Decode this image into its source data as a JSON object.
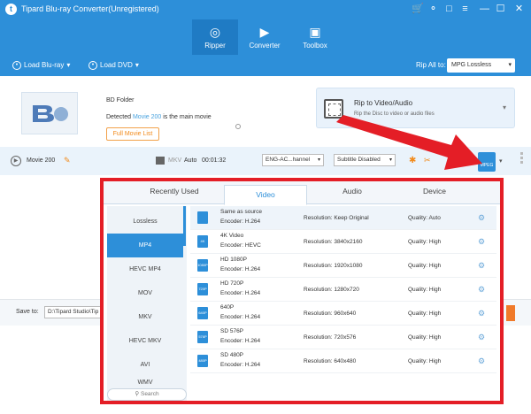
{
  "app": {
    "title": "Tipard Blu-ray Converter(Unregistered)"
  },
  "window_controls": {
    "cart_icon": "cart-icon",
    "key_icon": "key-icon",
    "chat_icon": "chat-icon",
    "menu_icon": "menu-icon",
    "minimize": "—",
    "maximize": "☐",
    "close": "✕"
  },
  "top_tabs": [
    {
      "label": "Ripper",
      "icon": "ripper-icon",
      "active": true
    },
    {
      "label": "Converter",
      "icon": "converter-icon",
      "active": false
    },
    {
      "label": "Toolbox",
      "icon": "toolbox-icon",
      "active": false
    }
  ],
  "toolbar": {
    "load_bluray": "Load Blu-ray",
    "load_dvd": "Load DVD",
    "rip_all_label": "Rip All to:",
    "rip_all_value": "MPG Lossless"
  },
  "source": {
    "folder": "BD Folder",
    "detected_prefix": "Detected ",
    "detected_movie": "Movie 200",
    "detected_suffix": " is the main movie",
    "full_list_button": "Full Movie List"
  },
  "rip_mode": {
    "title": "Rip to Video/Audio",
    "description": "Rip the Disc to video or audio files"
  },
  "movie_row": {
    "name": "Movie 200",
    "format": "MKV",
    "resolution": "Auto",
    "duration": "00:01:32",
    "audio_track": "ENG-AC...hannel",
    "subtitle": "Subtitle Disabled",
    "format_badge": "MPEG"
  },
  "save": {
    "label": "Save to:",
    "path": "D:\\Tipard Studio\\Tip"
  },
  "popup": {
    "tabs": [
      {
        "label": "Recently Used",
        "active": false
      },
      {
        "label": "Video",
        "active": true
      },
      {
        "label": "Audio",
        "active": false
      },
      {
        "label": "Device",
        "active": false
      }
    ],
    "categories": [
      "Lossless",
      "MP4",
      "HEVC MP4",
      "MOV",
      "MKV",
      "HEVC MKV",
      "AVI",
      "WMV"
    ],
    "active_category": "MP4",
    "search_placeholder": "Search",
    "presets": [
      {
        "name": "Same as source",
        "encoder": "Encoder: H.264",
        "resolution": "Resolution: Keep Original",
        "quality": "Quality: Auto",
        "badge": ""
      },
      {
        "name": "4K Video",
        "encoder": "Encoder: HEVC",
        "resolution": "Resolution: 3840x2160",
        "quality": "Quality: High",
        "badge": "4K"
      },
      {
        "name": "HD 1080P",
        "encoder": "Encoder: H.264",
        "resolution": "Resolution: 1920x1080",
        "quality": "Quality: High",
        "badge": "1080P"
      },
      {
        "name": "HD 720P",
        "encoder": "Encoder: H.264",
        "resolution": "Resolution: 1280x720",
        "quality": "Quality: High",
        "badge": "720P"
      },
      {
        "name": "640P",
        "encoder": "Encoder: H.264",
        "resolution": "Resolution: 960x640",
        "quality": "Quality: High",
        "badge": "640P"
      },
      {
        "name": "SD 576P",
        "encoder": "Encoder: H.264",
        "resolution": "Resolution: 720x576",
        "quality": "Quality: High",
        "badge": "576P"
      },
      {
        "name": "SD 480P",
        "encoder": "Encoder: H.264",
        "resolution": "Resolution: 640x480",
        "quality": "Quality: High",
        "badge": "480P"
      }
    ]
  },
  "colors": {
    "brand": "#2d8fd9",
    "highlight_box": "#e41e26",
    "accent": "#f28a1a"
  }
}
